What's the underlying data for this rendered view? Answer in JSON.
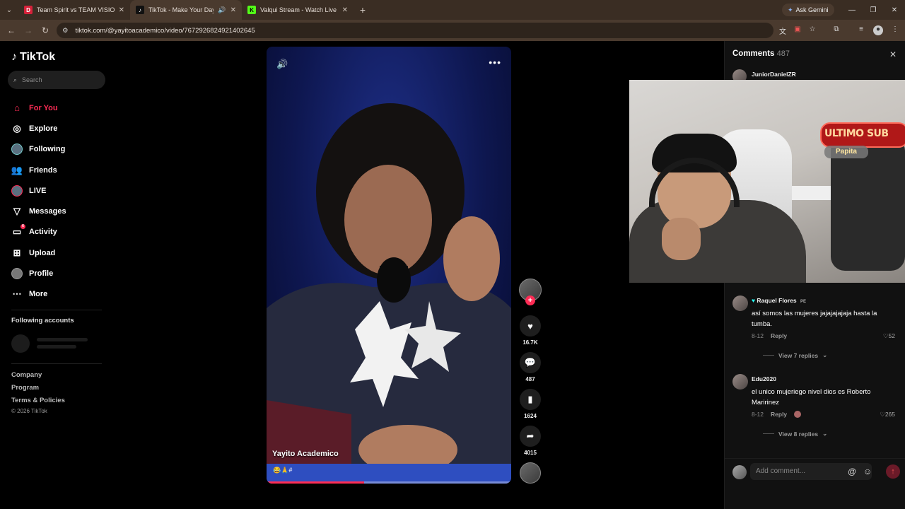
{
  "browser": {
    "tabs": [
      {
        "title": "Team Spirit vs TEAM VISION - ",
        "favicon": "D",
        "favicon_color": "#d6223a",
        "active": false
      },
      {
        "title": "TikTok - Make Your Day",
        "favicon": "♪",
        "favicon_color": "#111111",
        "active": true
      },
      {
        "title": "Valqui Stream - Watch Live on ",
        "favicon": "K",
        "favicon_color": "#53fc18",
        "active": false
      }
    ],
    "ask_gemini": "Ask Gemini",
    "url": "tiktok.com/@yayitoacademico/video/7672926824921402645"
  },
  "sidebar": {
    "logo": "TikTok",
    "search_placeholder": "Search",
    "nav": [
      {
        "label": "For You",
        "icon": "home-icon",
        "active": true
      },
      {
        "label": "Explore",
        "icon": "compass-icon",
        "active": false
      },
      {
        "label": "Following",
        "icon": "following-avatar-icon",
        "active": false
      },
      {
        "label": "Friends",
        "icon": "friends-icon",
        "active": false
      },
      {
        "label": "LIVE",
        "icon": "live-avatar-icon",
        "active": false
      },
      {
        "label": "Messages",
        "icon": "messages-icon",
        "active": false
      },
      {
        "label": "Activity",
        "icon": "activity-icon",
        "active": false,
        "badge": "6"
      },
      {
        "label": "Upload",
        "icon": "upload-icon",
        "active": false
      },
      {
        "label": "Profile",
        "icon": "profile-avatar-icon",
        "active": false
      },
      {
        "label": "More",
        "icon": "more-dots-icon",
        "active": false
      }
    ],
    "following_accounts_title": "Following accounts",
    "footer": {
      "company": "Company",
      "program": "Program",
      "terms": "Terms & Policies",
      "copyright": "© 2026 TikTok"
    }
  },
  "video": {
    "author": "Yayito Academico",
    "caption": "😂🙏#",
    "progress": 0.4,
    "likes": "16.7K",
    "comments": "487",
    "saves": "1624",
    "shares": "4015"
  },
  "comments_panel": {
    "title": "Comments",
    "count": "487",
    "top_user": "JuniorDanielZR",
    "items": [
      {
        "user": "Raquel Flores",
        "flag": "PE",
        "text": "así somos las mujeres jajajajajaja hasta la tumba.",
        "date": "8-12",
        "reply": "Reply",
        "likes": "52",
        "view_replies": "View 7 replies"
      },
      {
        "user": "Edu2020",
        "text": "el unico mujeriego nivel dios es Roberto Maririnez",
        "date": "8-12",
        "reply": "Reply",
        "likes": "265",
        "view_replies": "View 8 replies"
      }
    ],
    "add_placeholder": "Add comment..."
  },
  "webcam": {
    "sub_title": "ULTIMO SUB",
    "sub_name": "Papita"
  },
  "colors": {
    "accent": "#fe2c55",
    "chrome": "#3a2d23"
  }
}
